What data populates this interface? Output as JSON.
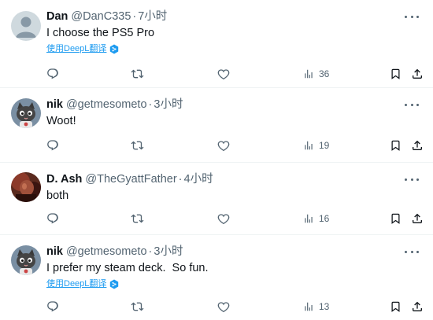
{
  "tweets": [
    {
      "name": "Dan",
      "handle": "@DanC335",
      "sep": "·",
      "time": "7小时",
      "text": "I choose the PS5 Pro",
      "translate": "使用DeepL翻译",
      "views": "36",
      "avatar": "default-avatar"
    },
    {
      "name": "nik",
      "handle": "@getmesometo",
      "sep": "·",
      "time": "3小时",
      "text": "Woot!",
      "translate": "",
      "views": "19",
      "avatar": "cat-avatar"
    },
    {
      "name": "D. Ash",
      "handle": "@TheGyattFather",
      "sep": "·",
      "time": "4小时",
      "text": "both",
      "translate": "",
      "views": "16",
      "avatar": "photo-avatar"
    },
    {
      "name": "nik",
      "handle": "@getmesometo",
      "sep": "·",
      "time": "3小时",
      "text": "I prefer my steam deck.  So fun.",
      "translate": "使用DeepL翻译",
      "views": "13",
      "avatar": "cat-avatar"
    }
  ],
  "colors": {
    "text": "#0f1419",
    "secondary": "#536471",
    "link": "#1d9bf0",
    "divider": "#eff3f4"
  },
  "icons": [
    "reply-icon",
    "retweet-icon",
    "like-icon",
    "views-icon",
    "bookmark-icon",
    "share-icon",
    "more-icon",
    "deepl-icon"
  ]
}
